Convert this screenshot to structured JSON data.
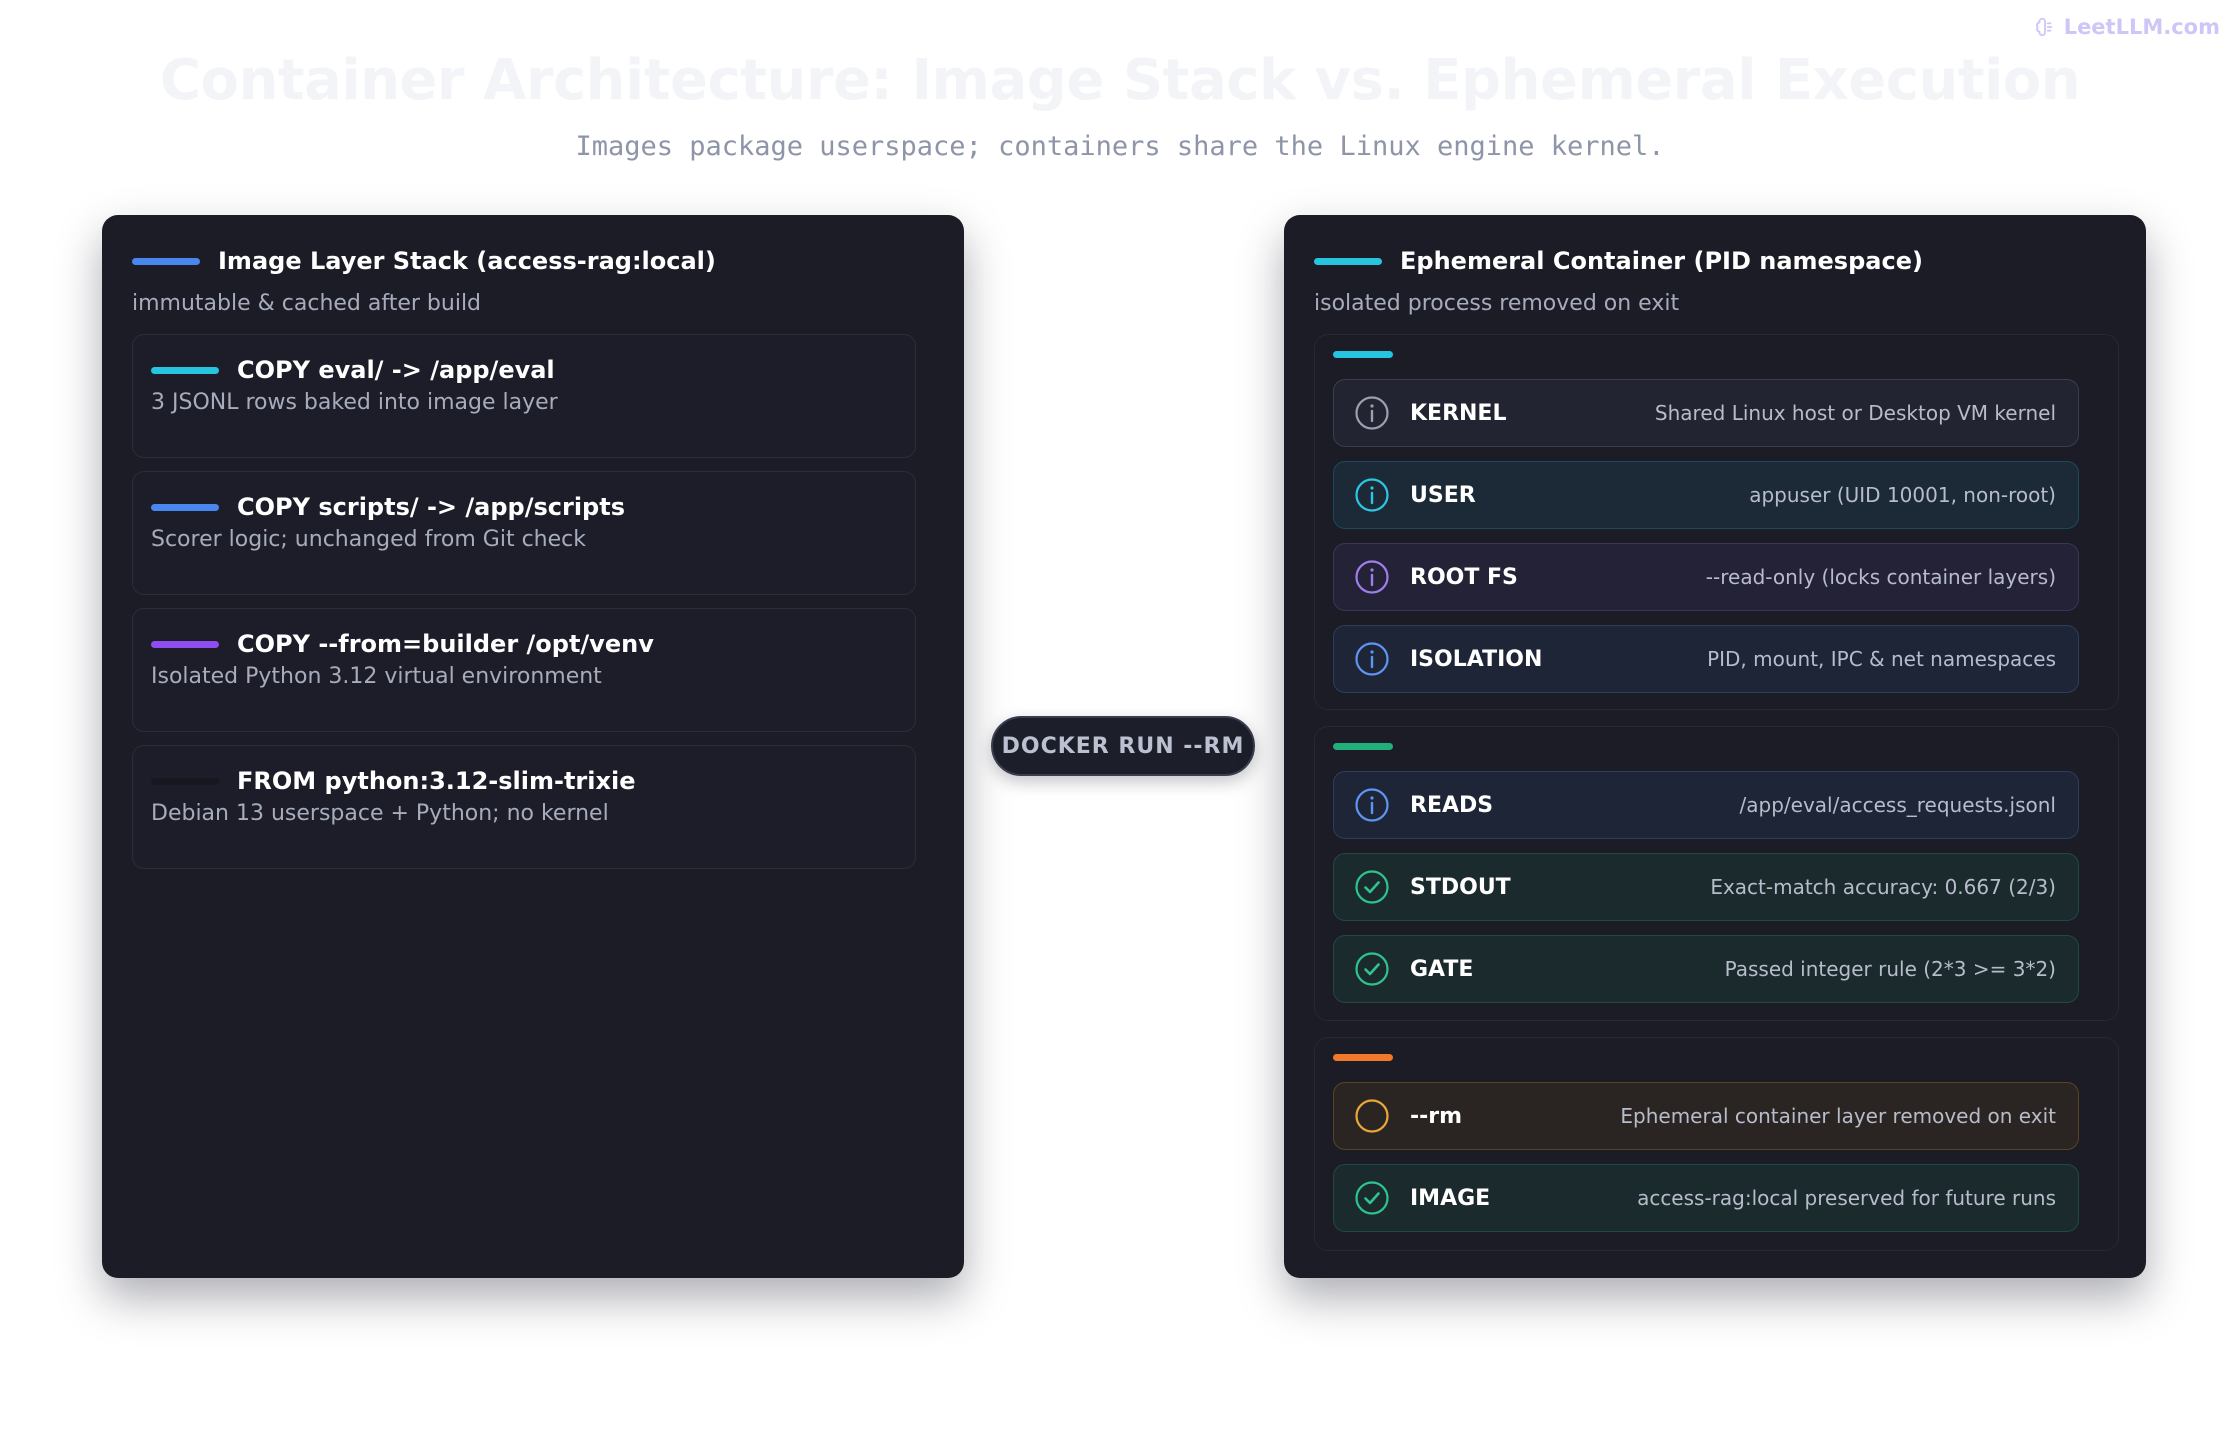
{
  "brand": {
    "name": "LeetLLM.com",
    "icon": "brain-icon",
    "color": "#cfc6f7"
  },
  "title": "Container Architecture: Image Stack vs. Ephemeral Execution",
  "subtitle": "Images package userspace; containers share the Linux engine kernel.",
  "connector": {
    "label": "DOCKER RUN --RM"
  },
  "left_panel": {
    "title": "Image Layer Stack (access-rag:local)",
    "subtitle": "immutable & cached after build",
    "accent": "#4a86f0",
    "layers": [
      {
        "title": "COPY eval/ -> /app/eval",
        "desc": "3 JSONL rows baked into image layer",
        "accent": "#27c4e0"
      },
      {
        "title": "COPY scripts/ -> /app/scripts",
        "desc": "Scorer logic; unchanged from Git check",
        "accent": "#4a86f0"
      },
      {
        "title": "COPY --from=builder /opt/venv",
        "desc": "Isolated Python 3.12 virtual environment",
        "accent": "#8d4df0"
      },
      {
        "title": "FROM python:3.12-slim-trixie",
        "desc": "Debian 13 userspace + Python; no kernel",
        "accent": "#16171f"
      }
    ]
  },
  "right_panel": {
    "title": "Ephemeral Container (PID namespace)",
    "subtitle": "isolated process removed on exit",
    "accent": "#27c4e0",
    "groups": [
      {
        "accent": "#27c4e0",
        "rows": [
          {
            "label": "KERNEL",
            "value": "Shared Linux host or Desktop VM kernel",
            "icon": "info-icon",
            "theme": "gray"
          },
          {
            "label": "USER",
            "value": "appuser (UID 10001, non-root)",
            "icon": "info-icon",
            "theme": "cyan"
          },
          {
            "label": "ROOT FS",
            "value": "--read-only (locks container layers)",
            "icon": "info-icon",
            "theme": "purple"
          },
          {
            "label": "ISOLATION",
            "value": "PID, mount, IPC & net namespaces",
            "icon": "info-icon",
            "theme": "blue"
          }
        ]
      },
      {
        "accent": "#21b07a",
        "rows": [
          {
            "label": "READS",
            "value": "/app/eval/access_requests.jsonl",
            "icon": "info-icon",
            "theme": "blue"
          },
          {
            "label": "STDOUT",
            "value": "Exact-match accuracy: 0.667 (2/3)",
            "icon": "check-circle-icon",
            "theme": "green"
          },
          {
            "label": "GATE",
            "value": "Passed integer rule (2*3 >= 3*2)",
            "icon": "check-circle-icon",
            "theme": "green"
          }
        ]
      },
      {
        "accent": "#f07a2a",
        "rows": [
          {
            "label": "--rm",
            "value": "Ephemeral container layer removed on exit",
            "icon": "circle-icon",
            "theme": "amber"
          },
          {
            "label": "IMAGE",
            "value": "access-rag:local preserved for future runs",
            "icon": "check-circle-icon",
            "theme": "green"
          }
        ]
      }
    ]
  },
  "themes": {
    "gray": {
      "bg": "#222431",
      "border": "#3a3d4d",
      "icon": "#9aa0b2"
    },
    "cyan": {
      "bg": "#1b2a36",
      "border": "#1d4a5a",
      "icon": "#2fc6e6"
    },
    "purple": {
      "bg": "#242236",
      "border": "#3a3656",
      "icon": "#a07ef0"
    },
    "blue": {
      "bg": "#1e2537",
      "border": "#2d3d5e",
      "icon": "#5f95f2"
    },
    "green": {
      "bg": "#1b2a2d",
      "border": "#1f4a40",
      "icon": "#2ec490"
    },
    "amber": {
      "bg": "#2a2522",
      "border": "#5a4422",
      "icon": "#e8a93a"
    }
  }
}
